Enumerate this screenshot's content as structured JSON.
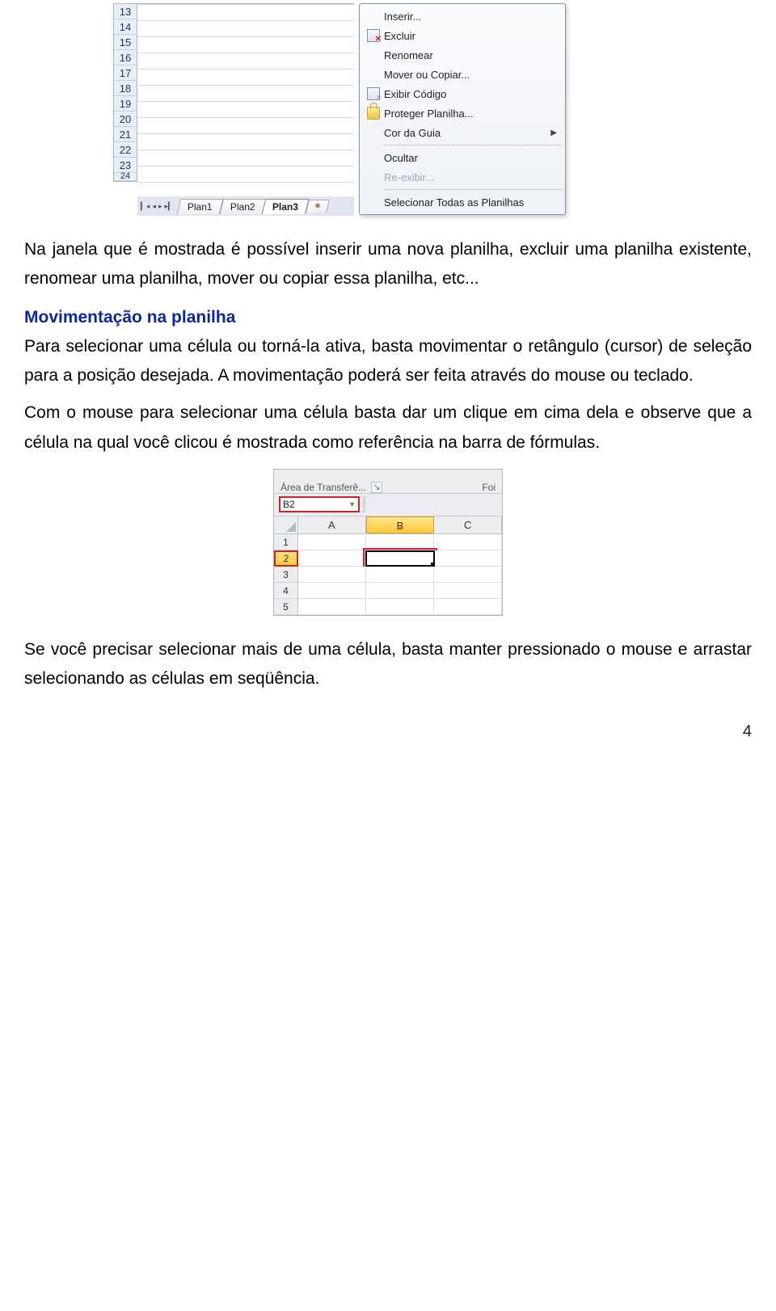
{
  "excel1": {
    "row_headers": [
      "13",
      "14",
      "15",
      "16",
      "17",
      "18",
      "19",
      "20",
      "21",
      "22",
      "23",
      "24"
    ],
    "sheet_tabs": [
      "Plan1",
      "Plan2",
      "Plan3"
    ],
    "active_tab_index": 2,
    "context_menu": {
      "insert": "Inserir...",
      "delete": "Excluir",
      "rename": "Renomear",
      "move_copy": "Mover ou Copiar...",
      "view_code": "Exibir Código",
      "protect": "Proteger Planilha...",
      "tab_color": "Cor da Guia",
      "hide": "Ocultar",
      "unhide": "Re-exibir...",
      "select_all": "Selecionar Todas as Planilhas"
    }
  },
  "body": {
    "p1": "Na janela que é mostrada é possível inserir uma nova planilha, excluir uma planilha existente, renomear uma planilha, mover ou copiar essa planilha, etc...",
    "h_movimentacao": "Movimentação na planilha",
    "p2": "Para selecionar uma célula ou torná-la ativa, basta movimentar o retângulo (cursor) de seleção para a posição desejada. A movimentação poderá ser feita através do mouse ou teclado.",
    "p3": "Com o mouse para selecionar uma célula basta dar um clique em cima dela e observe que a célula na qual você clicou é mostrada como referência na barra de fórmulas.",
    "p4": "Se você precisar selecionar mais de uma célula, basta manter pressionado o mouse e arrastar selecionando as células em seqüência."
  },
  "excel2": {
    "ribbon_group": "Área de Transferê...",
    "ribbon_right": "Foi",
    "namebox_value": "B2",
    "col_headers": [
      "A",
      "B",
      "C"
    ],
    "active_col_index": 1,
    "row_headers": [
      "1",
      "2",
      "3",
      "4",
      "5"
    ],
    "active_row_index": 1
  },
  "page_number": "4"
}
